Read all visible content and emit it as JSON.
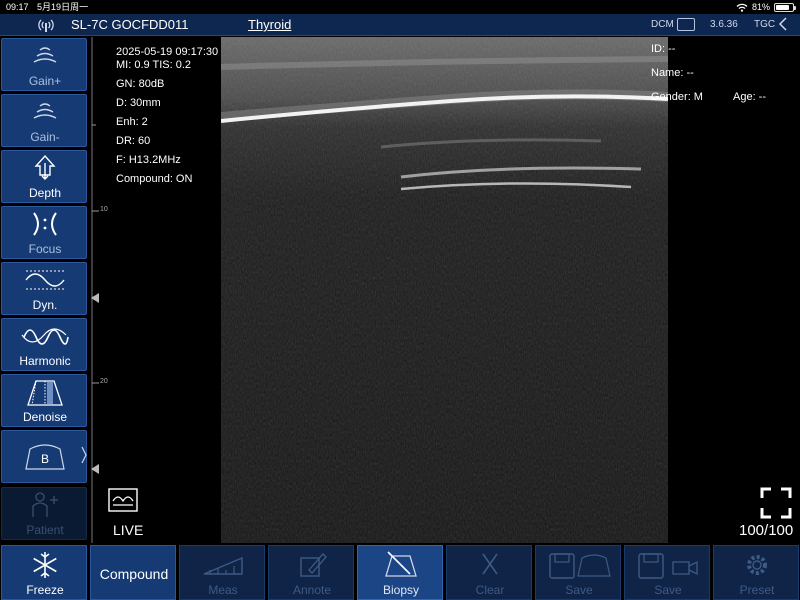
{
  "statusbar": {
    "time": "09:17",
    "date": "5月19日周一",
    "battery": "81%",
    "battery_level": 0.81
  },
  "topbar": {
    "device": "SL-7C GOCFDD011",
    "exam": "Thyroid",
    "dcm": "DCM",
    "version": "3.6.36",
    "tgc": "TGC"
  },
  "sidebar": [
    {
      "label": "Gain+",
      "icon": "gain-up-icon"
    },
    {
      "label": "Gain-",
      "icon": "gain-down-icon"
    },
    {
      "label": "Depth",
      "icon": "depth-icon"
    },
    {
      "label": "Focus",
      "icon": "focus-icon"
    },
    {
      "label": "Dyn.",
      "icon": "dynamic-range-icon"
    },
    {
      "label": "Harmonic",
      "icon": "harmonic-icon"
    },
    {
      "label": "Denoise",
      "icon": "denoise-icon"
    },
    {
      "label": "B",
      "icon": "b-mode-icon"
    },
    {
      "label": "Patient",
      "icon": "patient-icon"
    }
  ],
  "params": {
    "datetime": "2025-05-19 09:17:30",
    "mi_tis": "MI: 0.9  TIS: 0.2",
    "gain": "GN: 80dB",
    "depth": "D: 30mm",
    "enhance": "Enh: 2",
    "dynamic_range": "DR: 60",
    "frequency": "F: H13.2MHz",
    "compound": "Compound: ON"
  },
  "patient": {
    "id": "ID: --",
    "name": "Name: --",
    "gender": "Gender: M",
    "age": "Age: --"
  },
  "ruler": {
    "tick_10": "10",
    "tick_20": "20"
  },
  "image": {
    "live_label": "LIVE",
    "zoom_label": "100/100"
  },
  "toolbar": [
    {
      "label": "Freeze",
      "icon": "snowflake-icon",
      "state": "on"
    },
    {
      "label": "Compound",
      "state": "active"
    },
    {
      "label": "Meas",
      "icon": "measure-icon",
      "state": "disabled"
    },
    {
      "label": "Annote",
      "icon": "annotate-icon",
      "state": "disabled"
    },
    {
      "label": "Biopsy",
      "icon": "biopsy-icon",
      "state": "active"
    },
    {
      "label": "Clear",
      "icon": "clear-icon",
      "state": "disabled"
    },
    {
      "label": "Save",
      "icon": "save-image-icon",
      "state": "disabled"
    },
    {
      "label": "Save",
      "icon": "save-video-icon",
      "state": "disabled"
    },
    {
      "label": "Preset",
      "icon": "preset-gear-icon",
      "state": "disabled"
    }
  ],
  "colors": {
    "topbar": "#0e2750",
    "button": "#163a74",
    "button_border": "#2c579a",
    "disabled_text": "#3e5a85"
  }
}
